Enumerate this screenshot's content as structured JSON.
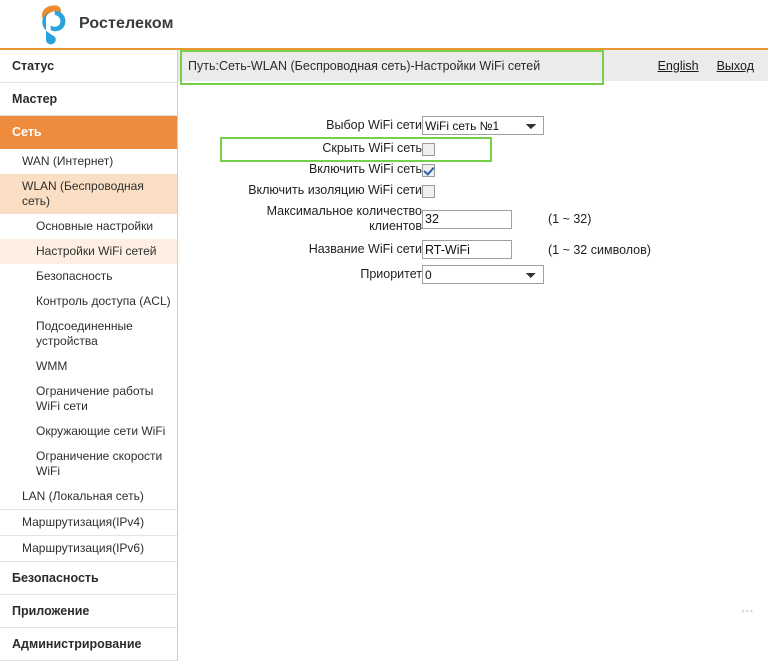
{
  "brand": {
    "name": "Ростелеком",
    "logo_icon": "rostelecom-logo-icon",
    "orange": "#ef8b3c",
    "blue": "#29a3dc",
    "highlight_green": "#78d04a"
  },
  "sidebar": {
    "sections": [
      {
        "label": "Статус",
        "active": false
      },
      {
        "label": "Мастер",
        "active": false
      },
      {
        "label": "Сеть",
        "active": true
      }
    ],
    "items": [
      {
        "label": "WAN (Интернет)",
        "level": 1,
        "highlight": "none"
      },
      {
        "label": "WLAN (Беспроводная сеть)",
        "level": 1,
        "highlight": "strong"
      },
      {
        "label": "Основные настройки",
        "level": 2,
        "highlight": "none"
      },
      {
        "label": "Настройки WiFi сетей",
        "level": 2,
        "highlight": "soft"
      },
      {
        "label": "Безопасность",
        "level": 2,
        "highlight": "none"
      },
      {
        "label": "Контроль доступа (ACL)",
        "level": 2,
        "highlight": "none"
      },
      {
        "label": "Подсоединенные устройства",
        "level": 2,
        "highlight": "none"
      },
      {
        "label": "WMM",
        "level": 2,
        "highlight": "none"
      },
      {
        "label": "Ограничение работы WiFi сети",
        "level": 2,
        "highlight": "none"
      },
      {
        "label": "Окружающие сети WiFi",
        "level": 2,
        "highlight": "none"
      },
      {
        "label": "Ограничение скорости WiFi",
        "level": 2,
        "highlight": "none"
      },
      {
        "label": "LAN (Локальная сеть)",
        "level": 1,
        "highlight": "none"
      },
      {
        "label": "Маршрутизация(IPv4)",
        "level": 1,
        "highlight": "none"
      },
      {
        "label": "Маршрутизация(IPv6)",
        "level": 1,
        "highlight": "none"
      }
    ],
    "bottom_sections": [
      {
        "label": "Безопасность"
      },
      {
        "label": "Приложение"
      },
      {
        "label": "Администрирование"
      }
    ]
  },
  "path_bar": {
    "text": "Путь:Сеть-WLAN (Беспроводная сеть)-Настройки WiFi сетей",
    "links": [
      {
        "label": "English",
        "name": "language-english-link"
      },
      {
        "label": "Выход",
        "name": "logout-link"
      }
    ]
  },
  "form": {
    "rows": [
      {
        "label": "Выбор WiFi сети",
        "type": "select",
        "value": "WiFi сеть №1",
        "options": [
          "WiFi сеть №1"
        ],
        "hint": ""
      },
      {
        "label": "Скрыть WiFi сеть",
        "type": "checkbox",
        "checked": false,
        "hint": ""
      },
      {
        "label": "Включить WiFi сеть",
        "type": "checkbox",
        "checked": true,
        "hint": ""
      },
      {
        "label": "Включить изоляцию WiFi сети",
        "type": "checkbox",
        "checked": false,
        "hint": ""
      },
      {
        "label": "Максимальное количество клиентов",
        "type": "text",
        "value": "32",
        "hint": "(1 ~ 32)"
      },
      {
        "label": "Название WiFi сети",
        "type": "text",
        "value": "RT-WiFi",
        "hint": "(1 ~ 32 символов)"
      },
      {
        "label": "Приоритет",
        "type": "select",
        "value": "0",
        "options": [
          "0"
        ],
        "hint": ""
      }
    ]
  },
  "watermark": {
    "text": "•••"
  }
}
